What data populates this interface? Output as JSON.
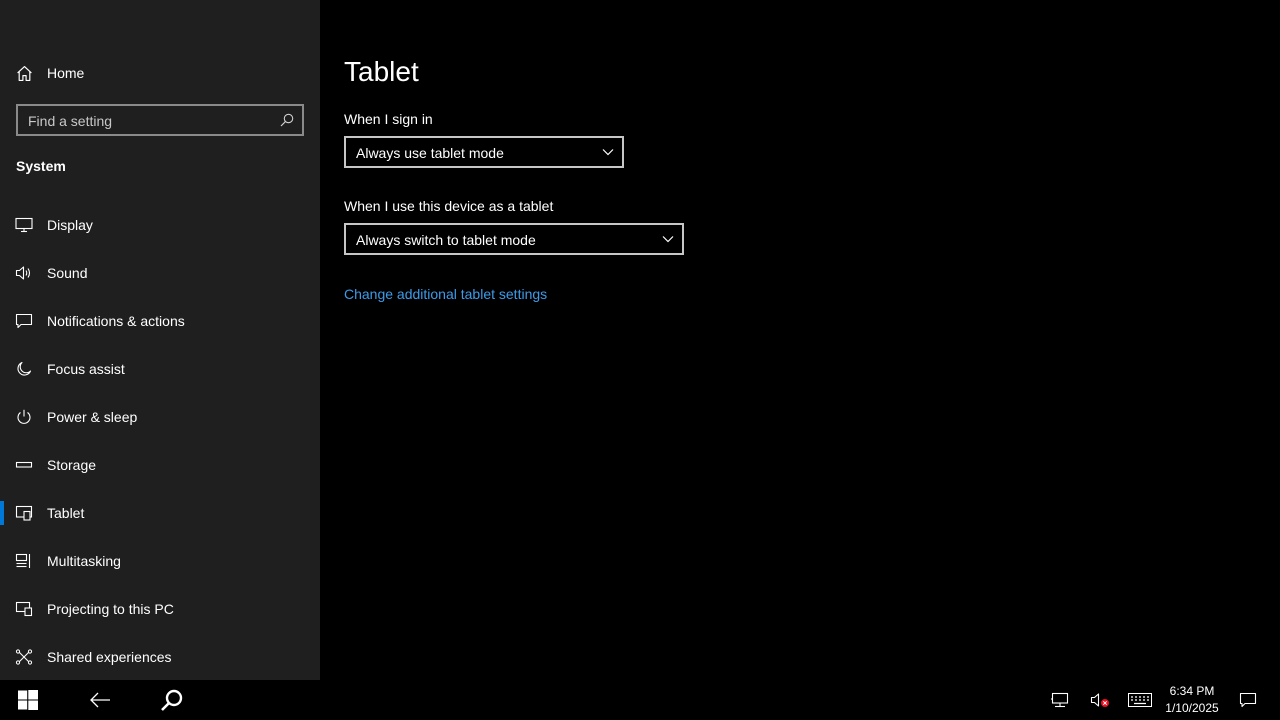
{
  "sidebar": {
    "home_label": "Home",
    "search_placeholder": "Find a setting",
    "section_title": "System",
    "items": [
      {
        "label": "Display",
        "icon": "monitor-icon"
      },
      {
        "label": "Sound",
        "icon": "speaker-icon"
      },
      {
        "label": "Notifications & actions",
        "icon": "notification-icon"
      },
      {
        "label": "Focus assist",
        "icon": "moon-icon"
      },
      {
        "label": "Power & sleep",
        "icon": "power-icon"
      },
      {
        "label": "Storage",
        "icon": "storage-icon"
      },
      {
        "label": "Tablet",
        "icon": "tablet-icon",
        "selected": true
      },
      {
        "label": "Multitasking",
        "icon": "multitasking-icon"
      },
      {
        "label": "Projecting to this PC",
        "icon": "projecting-icon"
      },
      {
        "label": "Shared experiences",
        "icon": "shared-experiences-icon"
      }
    ]
  },
  "main": {
    "title": "Tablet",
    "sign_in_label": "When I sign in",
    "sign_in_value": "Always use tablet mode",
    "device_label": "When I use this device as a tablet",
    "device_value": "Always switch to tablet mode",
    "link_text": "Change additional tablet settings"
  },
  "taskbar": {
    "time": "6:34 PM",
    "date": "1/10/2025",
    "icons": [
      "windows-start-icon",
      "back-arrow-icon",
      "search-icon",
      "network-icon",
      "volume-muted-icon",
      "keyboard-icon",
      "action-center-icon"
    ]
  },
  "colors": {
    "accent": "#0078d7",
    "link": "#3d9be9",
    "sidebar_bg": "#1f1f1f",
    "main_bg": "#000000"
  }
}
